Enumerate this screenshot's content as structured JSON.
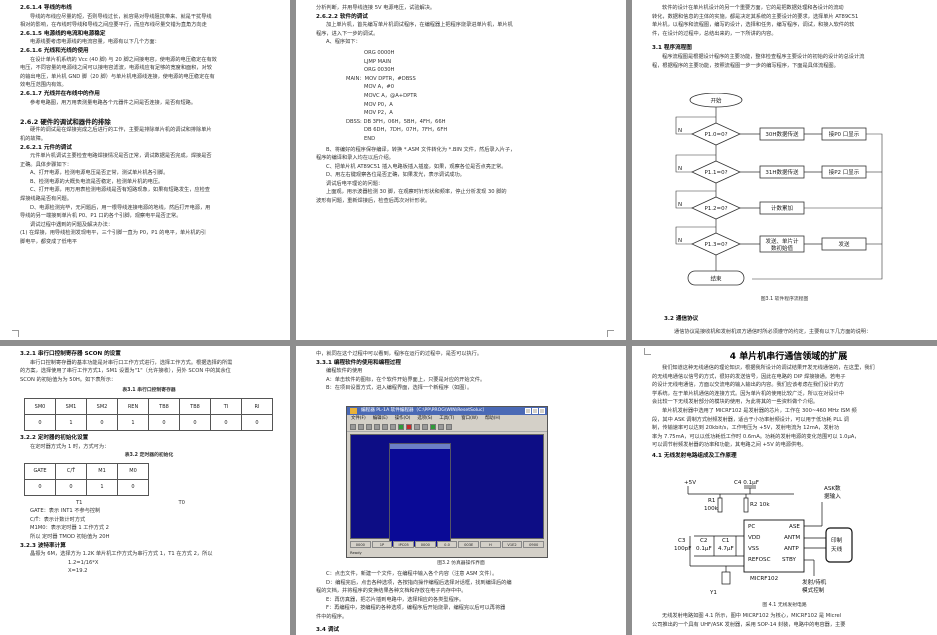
{
  "p1": {
    "lines": [
      {
        "t": "2.6.1.4   导线的布线",
        "c": "h"
      },
      {
        "t": "导线的布线应尽量的短，否则导线过长，就容易对导线阻抗带来、就是干扰导线",
        "c": "ind"
      },
      {
        "t": "相对的影响，在布线时导线和导线之间应要平行，而应布线尽量交错为直角方向走",
        "c": ""
      },
      {
        "t": "2.6.1.5   电源线的电流和电源稳定",
        "c": "h"
      },
      {
        "t": "电源线要考虑电源线的电流容量，电源有以下几个方面：",
        "c": "ind"
      },
      {
        "t": "2.6.1.6   光线和光线的使用",
        "c": "h"
      },
      {
        "t": "在设计单片机系统的 Vcc (40 脚) 与 20 脚之间接电容，使电源的电压稳定在有效",
        "c": "ind"
      },
      {
        "t": "电压，不同容量的电源线之间可以接电容滤波，电源线应有足够的宽度和面积，对较",
        "c": ""
      },
      {
        "t": "的输出电压，单片机 GND 脚（20 脚）与单片机电源线连接，使电源的电压稳定在有",
        "c": ""
      },
      {
        "t": "效电压范围内有效。",
        "c": ""
      },
      {
        "t": "2.6.1.7   光线并在布线中的作用",
        "c": "h"
      },
      {
        "t": "参考电路图，用万用表测量电路各个元器件之间是否连接，是否有短路。",
        "c": "ind"
      },
      {
        "t": "",
        "c": ""
      },
      {
        "t": "2.6.2   硬件的调试和器件的排除",
        "c": "big-h"
      },
      {
        "t": "硬件的调试是在焊接完成之后进行的工作，主要是排除单片机的调试和排除单片",
        "c": "ind"
      },
      {
        "t": "机的故障。",
        "c": ""
      },
      {
        "t": "2.6.2.1   元件的调试",
        "c": "h"
      },
      {
        "t": "元件单片机调试主要检查电路焊接情况是否正常，调试数据是否完成，焊接是否",
        "c": "ind"
      },
      {
        "t": "正确。具体步骤如下：",
        "c": ""
      },
      {
        "t": "A、打开电源，检测电源电压是否正常，测试单片机各引脚。",
        "c": "ind"
      },
      {
        "t": "B、检测电源的大概负电流是否稳定，检测单片机的电压。",
        "c": "ind"
      },
      {
        "t": "C、打开电源，用万用表检测电源线是否有短路现象，如果有短路发生，应检查",
        "c": "ind"
      },
      {
        "t": "焊接线路是否有问题。",
        "c": ""
      },
      {
        "t": "D、电源检测完毕，无问题后，用一根导线连接电源的地线，然后打开电源，用",
        "c": "ind"
      },
      {
        "t": "导线的另一端接到单片机 P0、P1 口的各个引脚，观察电平是否正常。",
        "c": ""
      },
      {
        "t": "调试过程中遇到的问题及解决办法：",
        "c": "ind"
      },
      {
        "t": "(1) 在焊接，用导线检测发现电平，三个引脚一直为 P0，P1 的电平，单片机的引",
        "c": ""
      },
      {
        "t": "脚电平，都变成了低电平",
        "c": ""
      }
    ]
  },
  "p2": {
    "lines": [
      {
        "t": "分析判断，并用导线连接 5V 电源电压，试验解决。",
        "c": ""
      },
      {
        "t": "2.6.2.2   软件的调试",
        "c": "h"
      },
      {
        "t": "加上单片机，首先编写单片机调试程序，在编程器上把程序烧录进单片机，单片机",
        "c": "ind"
      },
      {
        "t": "程序，进入下一步的调试。",
        "c": ""
      },
      {
        "t": "A、程序如下：",
        "c": "ind"
      }
    ],
    "code": [
      {
        "t": "ORG     0000H",
        "c": "code2"
      },
      {
        "t": "LJMP    MAIN",
        "c": "code2"
      },
      {
        "t": "ORG     0030H",
        "c": "code2"
      },
      {
        "t": "MAIN：MOV     DPTR，#DBSS",
        "c": "code"
      },
      {
        "t": "MOV    A，#0",
        "c": "code2"
      },
      {
        "t": "MOVC    A，@A+DPTR",
        "c": "code2"
      },
      {
        "t": "MOV     P0，A",
        "c": "code2"
      },
      {
        "t": "MOV     P2，A",
        "c": "code2"
      },
      {
        "t": "DBSS: DB    3FH，06H，5BH，4FH，66H",
        "c": "code"
      },
      {
        "t": "DB    6DH，7DH，07H，7FH，6FH",
        "c": "code2"
      },
      {
        "t": "END",
        "c": "code2"
      }
    ],
    "after": [
      {
        "t": "B、将编好的程序保存编译，转换 *.ASM 文件转化为 *.BIN 文件，然后录入片子，",
        "c": "ind"
      },
      {
        "t": "程序的编译和录入均在以后介绍。",
        "c": ""
      },
      {
        "t": "C、把单片机 AT89C51 插入电路板插入插座，如果，观察各位是否点亮正常。",
        "c": "ind"
      },
      {
        "t": "D、用左右键观察各位是否正确，如果发光，表示调试成功。",
        "c": "ind"
      },
      {
        "t": "调试后电平理论的问题：",
        "c": "ind"
      },
      {
        "t": "上面观，用示波器检测 30 脚，在观察时针形状和频率，停止分析发现 30 脚的",
        "c": "ind"
      },
      {
        "t": "波形有问题，重新焊接后，检查后再次对针形状。",
        "c": ""
      }
    ]
  },
  "p3": {
    "top": [
      {
        "t": "软件的设计在单片机设计的另一个重要方面，它的是把数据处理和各设计的流动",
        "c": "ind"
      },
      {
        "t": "转化，数据和信息的主体的实施，都是决定其系统的主要设计的要求，选择单片 AT89C51",
        "c": ""
      },
      {
        "t": "单片机，以程序和流程图，编写的设计，选择和任务，编写程序，调试，和接入软件的软",
        "c": ""
      },
      {
        "t": "件，在设计的过程中，总结出来的，一下所讲的内容。",
        "c": ""
      }
    ],
    "h31": "3.1   程序流程图",
    "desc": [
      {
        "t": "程序流程图是根据设计程序的主要功能，整体检查程序主要设计的初始的设计的总设计流",
        "c": "ind"
      },
      {
        "t": "程，根据程序的主要功能，按照流程图一步一步的编写程序，下面是具体流程图。",
        "c": ""
      }
    ],
    "flow": {
      "start": "开始",
      "end": "结束",
      "d1": "P1.0=0?",
      "d2": "P1.1=0?",
      "d3": "P1.2=0?",
      "d4": "P1.3=0?",
      "b1": "30H数据传送",
      "b2": "31H数据传送",
      "b3": "计数累加",
      "b4a": "发送、单片计",
      "b4b": "数初始值",
      "o1": "接P0 口显示",
      "o2": "接P2 口显示",
      "o4": "发送",
      "n": "N",
      "y": "Y"
    },
    "cap": "图3.1  软件程序流程图",
    "h32": "3.2   通信协议",
    "bottom": [
      {
        "t": "通信协议是接收机和发射机双方通信时所必须遵守的约定，主要有以下几方面的说明：",
        "c": "ind"
      }
    ]
  },
  "p4": {
    "lines": [
      {
        "t": "3.2.1   串行口控制寄存器 SCON 的设置",
        "c": "h"
      },
      {
        "t": "串行口控制寄存器的基本功能是对串行口工作方式进行，选择工作方式。根据选择的所需",
        "c": "ind"
      },
      {
        "t": "的方案，选择使用了串行工作方式1，SM1 设置为\"1\"（允许接收），另外 SCON 中的其余位",
        "c": ""
      },
      {
        "t": "SCON 的初始值为为 50H。如下表所示：",
        "c": ""
      }
    ],
    "t1cap": "表3.1  串行口控制寄存器",
    "t1head": [
      "SM0",
      "SM1",
      "SM2",
      "REN",
      "TB8",
      "TB8",
      "TI",
      "RI"
    ],
    "t1vals": [
      "0",
      "1",
      "0",
      "1",
      "0",
      "0",
      "0",
      "0"
    ],
    "s322": "3.2.2   定时器的初始化设置",
    "s322b": "在定时器方式为 1 时，方式可为：",
    "t2cap": "表3.2  定时器的初始化",
    "t2head": [
      "GATE",
      "C/T̄",
      "M1",
      "M0"
    ],
    "t2vals": [
      "0",
      "0",
      "1",
      "0"
    ],
    "t1": "T1",
    "t0": "T0",
    "after": [
      {
        "t": "GATE：表示 INT1 不参与控制",
        "c": "ind"
      },
      {
        "t": "C/T̄：表示计数计时方式",
        "c": "ind"
      },
      {
        "t": "M1M0：表示定时器 1 工作方式 2",
        "c": "ind"
      },
      {
        "t": "所以 定时器 TMOD 初始值为 20H",
        "c": "ind"
      },
      {
        "t": "3.2.3   波特率计算",
        "c": "h"
      },
      {
        "t": "晶振为 6M，选择方为 1.2K 单片机工作方式为串行方式 1，T1 在方式 2，所以",
        "c": "ind"
      },
      {
        "t": "1.2=1/16*X",
        "c": "code2"
      },
      {
        "t": "X=19.2",
        "c": "code2"
      }
    ]
  },
  "p5": {
    "top": [
      {
        "t": "中，就同在这个过程中可以看到，程序在运行的过程中，是否可以执行。",
        "c": ""
      },
      {
        "t": "3.3.1   编程软件的使用和编程过程",
        "c": "h"
      },
      {
        "t": "编程软件的使用",
        "c": "ind"
      },
      {
        "t": "A：单击软件的图标，在个软件开始界面上，只要是对应的开始文件。",
        "c": "ind"
      },
      {
        "t": "B：在项目设置方式，进入编程界面，选择一个新程序（如图）。",
        "c": "ind"
      }
    ],
    "win": {
      "title": "编程器 PL-1A   软件编程器（C:\\PP\\PROG\\WIN\\ResetSoluc）",
      "menu": [
        "文件(F)",
        "编辑(E)",
        "操作(O)",
        "选项(S)",
        "工具(T)",
        "窗口(W)",
        "帮助(H)"
      ],
      "status": [
        "0000",
        "1P",
        "IPC05",
        "0000",
        "0.0",
        "003E",
        "H",
        "V1E2",
        "0900"
      ],
      "statusbar": "Ready"
    },
    "cap": "图3.2  仿真器操作界面",
    "after": [
      {
        "t": "C：点击文件，新建一个文件，在编程中输入各个内容（注意 ASM 文件）。",
        "c": "ind"
      },
      {
        "t": "D：编程完后，点击各种选项，各按指向操作编程后选择对话框，找到编译后的编",
        "c": "ind"
      },
      {
        "t": "程的文档，并将程序的变换结果各种文档和存放在电子内存中中。",
        "c": ""
      },
      {
        "t": "E：再仿真器，把芯片插到电路中，选择相应的各类型程序。",
        "c": "ind"
      },
      {
        "t": "F：再编程中，按编程的各种选项，编程序后开始烧录，编程完以后可以再将器",
        "c": "ind"
      },
      {
        "t": "件中的程序。",
        "c": ""
      }
    ],
    "s34": "3.4   调试"
  },
  "p6": {
    "title": "4   单片机串行通信领域的扩展",
    "lines": [
      {
        "t": "我们知道这种无线通信的理论知识，根据我所设计的调试结果开发无线通信的，在这里，我们",
        "c": "ind"
      },
      {
        "t": "的无线电通信以信号的方式，很好的发送信号，因此在电路的 DIP 焊接接通。若电子",
        "c": ""
      },
      {
        "t": "的设计无线电通信，方面以交流电的输入输出的内容。我们应该考虑在我们设计的方",
        "c": ""
      },
      {
        "t": "学系统，在于单片机通信的连接方式。因为单片机的使用比较广泛，所以在对设计中",
        "c": ""
      },
      {
        "t": "会比较一下无线发射部分的模块的使用，为此将其的一些资料做个介绍。",
        "c": ""
      },
      {
        "t": "单片机发射器中选用了 MICRF102 是发射器的芯片，工作在 300~460 MHz ISM 频",
        "c": "ind"
      },
      {
        "t": "段，其中 ASK 调制方式射频发射器，适合于小功率射频设计，可以用于低功耗 PLL 调",
        "c": ""
      },
      {
        "t": "制，传输速率可以达到 20kbit/s，工作电压为 +5V，发射电流为 12mA，发射功",
        "c": ""
      },
      {
        "t": "率为 7.75mA，可以以低功耗低工作时 0.6mA。功耗的发射电源的变化范围可以 1.0μA，",
        "c": ""
      },
      {
        "t": "可以调节射频发射器的功率和功能，其电路之间 +5V 的电源供电。",
        "c": ""
      }
    ],
    "s41": "4.1   无线发射电路组成及工作原理",
    "circuit": {
      "vcc": "+5V",
      "c4": "C4 0.1μF",
      "r1": "R1",
      "r1v": "100k",
      "r2": "R2 10k",
      "ask": "ASK数",
      "ask2": "据输入",
      "pc": "PC",
      "vdd": "VDD",
      "vss": "VSS",
      "refosc": "REFOSC",
      "stby": "STBY",
      "ase": "ASE",
      "antm": "ANTM",
      "antp": "ANTP",
      "c3": "C3",
      "c3v": "100pF",
      "c2": "C2",
      "c2v": "0.1μF",
      "c1": "C1",
      "c1v": "4.7μF",
      "y1": "Y1",
      "chip": "MICRF102",
      "ant1": "印制",
      "ant2": "天线",
      "mode1": "发射/待机",
      "mode2": "模式控制"
    },
    "cap": "图 4.1  无线发射电路",
    "bottom": [
      {
        "t": "无线发射电路如图 4.1 所示，图中 MICRF102 为核心，MICRF102 是 Micrel",
        "c": "ind"
      },
      {
        "t": "公司推出的一个具有 UHF/ASK 发射器，采用 SOP-14 封装，电路中的电容器，主要",
        "c": ""
      }
    ]
  }
}
